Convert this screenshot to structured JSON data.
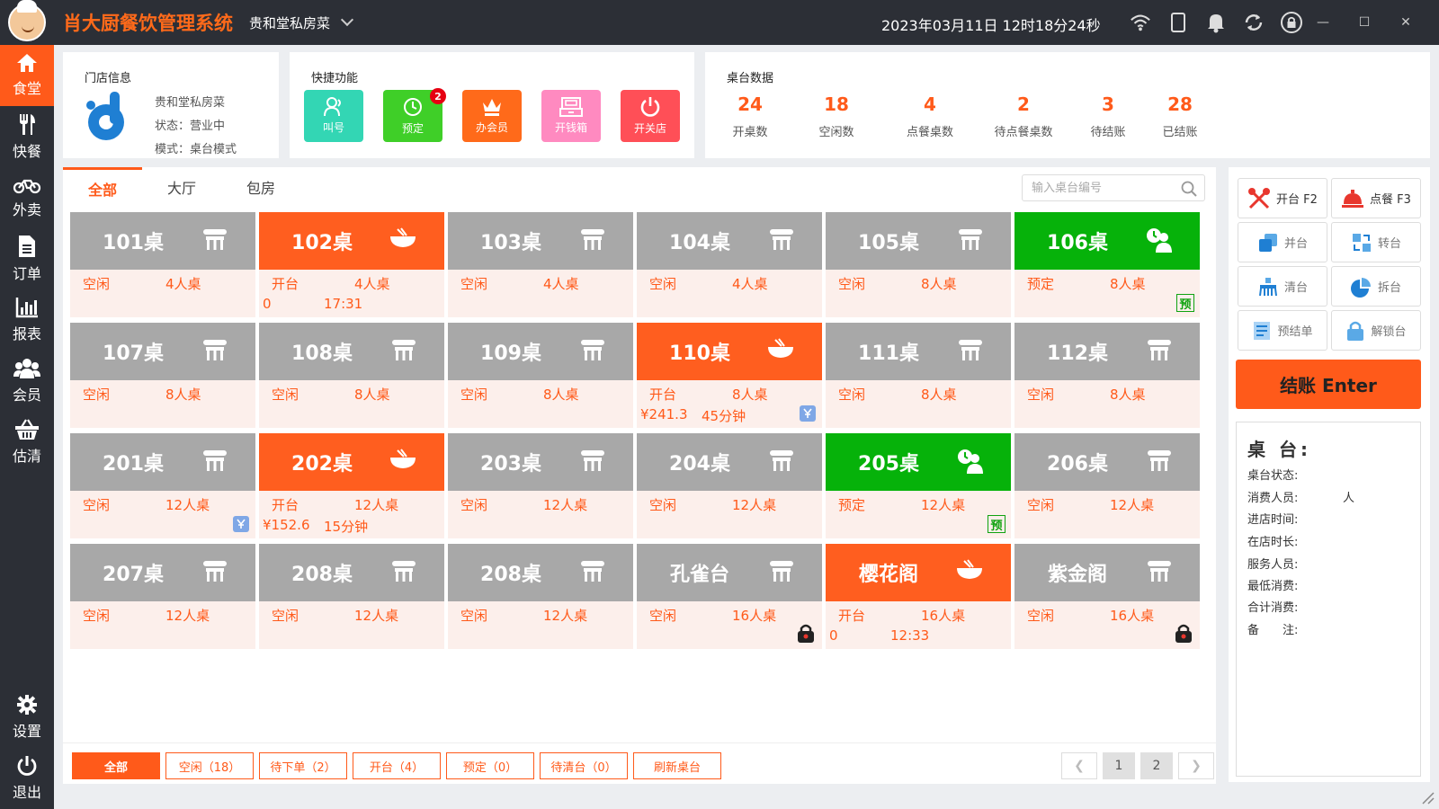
{
  "app": {
    "title": "肖大厨餐饮管理系统",
    "store_name": "贵和堂私房菜",
    "datetime": "2023年03月11日 12时18分24秒"
  },
  "nav": {
    "items": [
      {
        "label": "食堂",
        "icon": "home-icon",
        "active": true
      },
      {
        "label": "快餐",
        "icon": "cutlery-icon"
      },
      {
        "label": "外卖",
        "icon": "motorbike-icon"
      },
      {
        "label": "订单",
        "icon": "document-icon"
      },
      {
        "label": "报表",
        "icon": "bar-chart-icon"
      },
      {
        "label": "会员",
        "icon": "members-icon"
      },
      {
        "label": "估清",
        "icon": "basket-icon"
      }
    ],
    "settings_label": "设置",
    "logout_label": "退出"
  },
  "store_info": {
    "title": "门店信息",
    "name": "贵和堂私房菜",
    "status": "状态：营业中",
    "mode": "模式：桌台模式"
  },
  "quick": {
    "title": "快捷功能",
    "buttons": [
      {
        "label": "叫号",
        "color": "#33d6b4",
        "icon": "person-icon"
      },
      {
        "label": "预定",
        "color": "#3fcf28",
        "icon": "clock-icon",
        "badge": "2"
      },
      {
        "label": "办会员",
        "color": "#ff6a1a",
        "icon": "crown-icon"
      },
      {
        "label": "开钱箱",
        "color": "#ff8ac0",
        "icon": "cashbox-icon"
      },
      {
        "label": "开关店",
        "color": "#ff4f57",
        "icon": "power-icon"
      }
    ]
  },
  "table_data": {
    "title": "桌台数据",
    "stats": [
      {
        "num": "24",
        "label": "开桌数"
      },
      {
        "num": "18",
        "label": "空闲数"
      },
      {
        "num": "4",
        "label": "点餐桌数"
      },
      {
        "num": "2",
        "label": "待点餐桌数"
      },
      {
        "num": "3",
        "label": "待结账"
      },
      {
        "num": "28",
        "label": "已结账"
      }
    ]
  },
  "tabs": [
    "全部",
    "大厅",
    "包房"
  ],
  "search": {
    "placeholder": "输入桌台编号"
  },
  "tables": [
    {
      "name": "101桌",
      "state": "idle",
      "status": "空闲",
      "cap": "4人桌"
    },
    {
      "name": "102桌",
      "state": "open",
      "status": "开台",
      "cap": "4人桌",
      "amount": "0",
      "time": "17:31"
    },
    {
      "name": "103桌",
      "state": "idle",
      "status": "空闲",
      "cap": "4人桌"
    },
    {
      "name": "104桌",
      "state": "idle",
      "status": "空闲",
      "cap": "4人桌"
    },
    {
      "name": "105桌",
      "state": "idle",
      "status": "空闲",
      "cap": "8人桌"
    },
    {
      "name": "106桌",
      "state": "reserved",
      "status": "预定",
      "cap": "8人桌",
      "tag": "预"
    },
    {
      "name": "107桌",
      "state": "idle",
      "status": "空闲",
      "cap": "8人桌"
    },
    {
      "name": "108桌",
      "state": "idle",
      "status": "空闲",
      "cap": "8人桌"
    },
    {
      "name": "109桌",
      "state": "idle",
      "status": "空闲",
      "cap": "8人桌"
    },
    {
      "name": "110桌",
      "state": "open",
      "status": "开台",
      "cap": "8人桌",
      "amount": "¥241.3",
      "time": "45分钟",
      "yen": true
    },
    {
      "name": "111桌",
      "state": "idle",
      "status": "空闲",
      "cap": "8人桌"
    },
    {
      "name": "112桌",
      "state": "idle",
      "status": "空闲",
      "cap": "8人桌"
    },
    {
      "name": "201桌",
      "state": "idle",
      "status": "空闲",
      "cap": "12人桌",
      "yen": true
    },
    {
      "name": "202桌",
      "state": "open",
      "status": "开台",
      "cap": "12人桌",
      "amount": "¥152.6",
      "time": "15分钟"
    },
    {
      "name": "203桌",
      "state": "idle",
      "status": "空闲",
      "cap": "12人桌"
    },
    {
      "name": "204桌",
      "state": "idle",
      "status": "空闲",
      "cap": "12人桌"
    },
    {
      "name": "205桌",
      "state": "reserved",
      "status": "预定",
      "cap": "12人桌",
      "tag": "预"
    },
    {
      "name": "206桌",
      "state": "idle",
      "status": "空闲",
      "cap": "12人桌"
    },
    {
      "name": "207桌",
      "state": "idle",
      "status": "空闲",
      "cap": "12人桌"
    },
    {
      "name": "208桌",
      "state": "idle",
      "status": "空闲",
      "cap": "12人桌"
    },
    {
      "name": "208桌",
      "state": "idle",
      "status": "空闲",
      "cap": "12人桌"
    },
    {
      "name": "孔雀台",
      "state": "idle",
      "status": "空闲",
      "cap": "16人桌",
      "lock": true
    },
    {
      "name": "樱花阁",
      "state": "open",
      "status": "开台",
      "cap": "16人桌",
      "amount": "0",
      "time": "12:33"
    },
    {
      "name": "紫金阁",
      "state": "idle",
      "status": "空闲",
      "cap": "16人桌",
      "lock": true
    }
  ],
  "filters": [
    {
      "label": "全部",
      "active": true
    },
    {
      "label": "空闲（18）"
    },
    {
      "label": "待下单（2）"
    },
    {
      "label": "开台（4）"
    },
    {
      "label": "预定（0）"
    },
    {
      "label": "待清台（0）"
    },
    {
      "label": "刷新桌台"
    }
  ],
  "pager": {
    "prev": "❮",
    "pages": [
      "1",
      "2"
    ],
    "next": "❯"
  },
  "actions": [
    {
      "label": "开台 F2",
      "icon": "utensils-icon"
    },
    {
      "label": "点餐 F3",
      "icon": "service-bell-icon"
    },
    {
      "label": "并台",
      "icon": "merge-icon"
    },
    {
      "label": "转台",
      "icon": "transfer-icon"
    },
    {
      "label": "清台",
      "icon": "clear-table-icon"
    },
    {
      "label": "拆台",
      "icon": "split-icon"
    },
    {
      "label": "预结单",
      "icon": "receipt-icon"
    },
    {
      "label": "解锁台",
      "icon": "unlock-icon"
    }
  ],
  "pay_label": "结账 Enter",
  "table_info": {
    "title": "桌 台:",
    "rows": [
      "桌台状态:",
      "消费人员:",
      "进店时间:",
      "在店时长:",
      "服务人员:",
      "最低消费:",
      "合计消费:",
      "备　　注:"
    ],
    "person_unit": "人"
  }
}
